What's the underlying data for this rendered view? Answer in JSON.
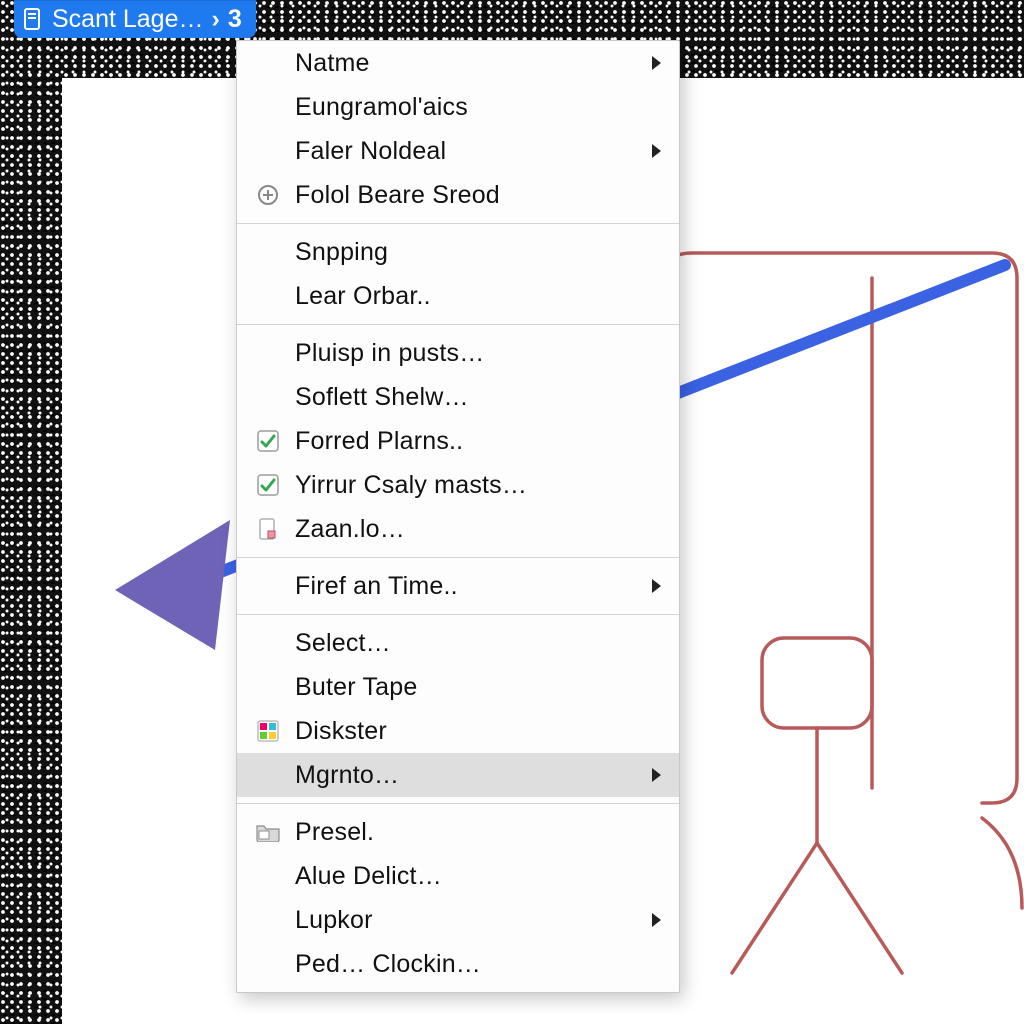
{
  "breadcrumb": {
    "title": "Scant Lage…",
    "count": "3"
  },
  "menu": {
    "groups": [
      [
        {
          "label": "Natme",
          "submenu": true
        },
        {
          "label": "Eungramol'aics"
        },
        {
          "label": "Faler Noldeal",
          "submenu": true
        },
        {
          "label": "Folol Beare Sreod",
          "icon": "plus-circle"
        }
      ],
      [
        {
          "label": "Snpping"
        },
        {
          "label": "Lear Orbar.."
        }
      ],
      [
        {
          "label": "Pluisp in pusts…"
        },
        {
          "label": "Soflett Shelw…"
        },
        {
          "label": "Forred Plarns..",
          "icon": "check"
        },
        {
          "label": "Yirrur Csaly masts…",
          "icon": "check"
        },
        {
          "label": "Zaan.lo…",
          "icon": "doc"
        }
      ],
      [
        {
          "label": "Firef an Time..",
          "submenu": true
        }
      ],
      [
        {
          "label": "Select…"
        },
        {
          "label": "Buter Tape"
        },
        {
          "label": "Diskster",
          "icon": "swatch"
        },
        {
          "label": "Mgrnto…",
          "submenu": true,
          "highlight": true
        }
      ],
      [
        {
          "label": "Presel.",
          "icon": "folder"
        },
        {
          "label": "Alue Delict…"
        },
        {
          "label": "Lupkor",
          "submenu": true
        },
        {
          "label": "Ped… Clockin…"
        }
      ]
    ]
  },
  "annotation": {
    "color": "#3a62e3",
    "arrowhead_color": "#6f63b8"
  }
}
